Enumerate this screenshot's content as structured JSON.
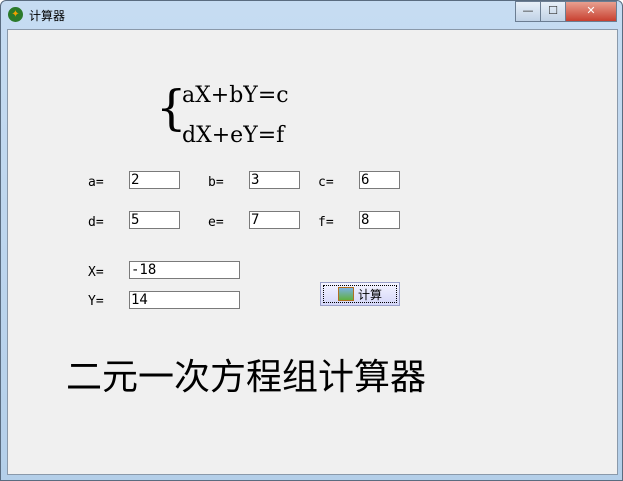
{
  "window": {
    "title": "计算器",
    "minimize": "—",
    "maximize": "☐",
    "close": "✕"
  },
  "equations": {
    "brace": "{",
    "line1": "aX+bY=c",
    "line2": "dX+eY=f"
  },
  "fields": [
    {
      "label": "a=",
      "value": "2"
    },
    {
      "label": "b=",
      "value": "3"
    },
    {
      "label": "c=",
      "value": "6"
    },
    {
      "label": "d=",
      "value": "5"
    },
    {
      "label": "e=",
      "value": "7"
    },
    {
      "label": "f=",
      "value": "8"
    }
  ],
  "results": {
    "x_label": "X=",
    "x_value": "-18",
    "y_label": "Y=",
    "y_value": "14"
  },
  "button": {
    "label": "计算"
  },
  "heading": "二元一次方程组计算器"
}
